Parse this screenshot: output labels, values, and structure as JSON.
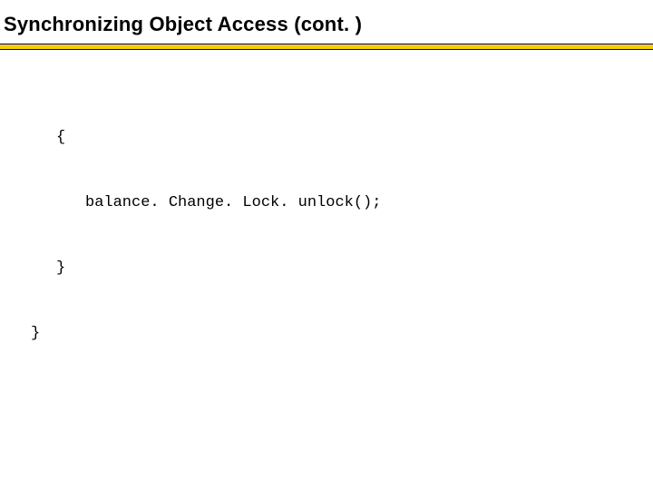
{
  "title": "Synchronizing Object Access  (cont. )",
  "code": {
    "l1": "{",
    "l2": "balance. Change. Lock. unlock();",
    "l3": "}",
    "l4": "}"
  }
}
